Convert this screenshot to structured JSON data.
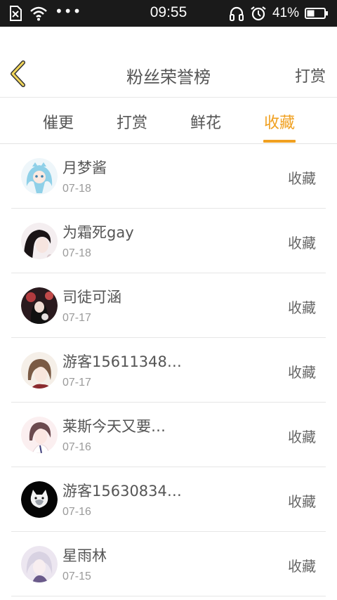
{
  "status_bar": {
    "time": "09:55",
    "battery_percent": "41%",
    "dots": "•••",
    "icons": [
      "sim-off-icon",
      "wifi-icon",
      "headphones-icon",
      "alarm-icon",
      "battery-icon"
    ]
  },
  "header": {
    "title": "粉丝荣誉榜",
    "right_link": "打赏",
    "back_icon": "chevron-left-icon"
  },
  "tabs": [
    {
      "label": "催更",
      "active": false
    },
    {
      "label": "打赏",
      "active": false
    },
    {
      "label": "鲜花",
      "active": false
    },
    {
      "label": "收藏",
      "active": true
    }
  ],
  "accent_color": "#f0a020",
  "fans": [
    {
      "name": "月梦酱",
      "date": "07-18",
      "action": "收藏"
    },
    {
      "name": "为霜死gay",
      "date": "07-18",
      "action": "收藏"
    },
    {
      "name": "司徒可涵",
      "date": "07-17",
      "action": "收藏"
    },
    {
      "name": "游客15611348…",
      "date": "07-17",
      "action": "收藏"
    },
    {
      "name": "莱斯今天又要…",
      "date": "07-16",
      "action": "收藏"
    },
    {
      "name": "游客15630834…",
      "date": "07-16",
      "action": "收藏"
    },
    {
      "name": "星雨林",
      "date": "07-15",
      "action": "收藏"
    }
  ]
}
